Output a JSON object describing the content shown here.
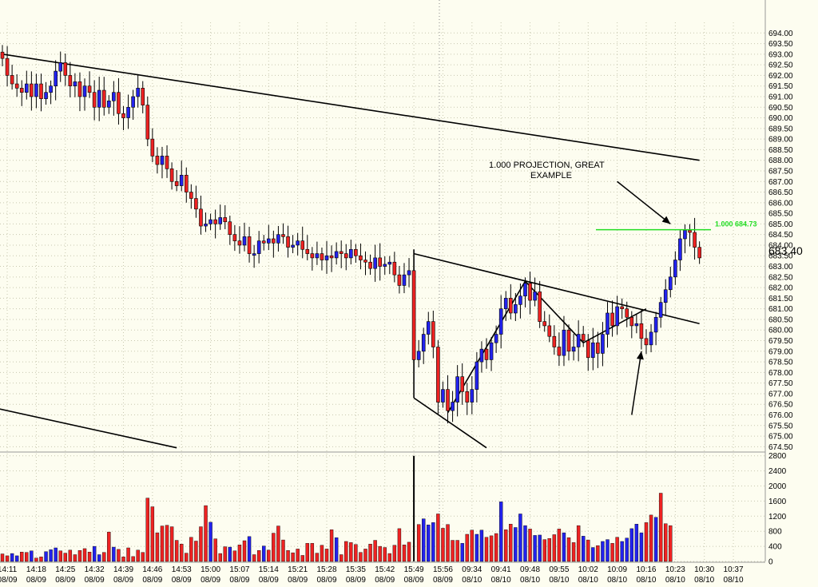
{
  "chart_data": {
    "type": "bar",
    "title": "",
    "ohlc_panel": {
      "ylim": [
        674.25,
        694.5
      ],
      "y_ticks": [
        "694.00",
        "693.50",
        "693.00",
        "692.50",
        "692.00",
        "691.50",
        "691.00",
        "690.50",
        "690.00",
        "689.50",
        "689.00",
        "688.50",
        "688.00",
        "687.50",
        "687.00",
        "686.50",
        "686.00",
        "685.50",
        "685.00",
        "684.50",
        "684.00",
        "683.50",
        "683.00",
        "682.50",
        "682.00",
        "681.50",
        "681.00",
        "680.50",
        "680.00",
        "679.50",
        "679.00",
        "678.50",
        "678.00",
        "677.50",
        "677.00",
        "676.50",
        "676.00",
        "675.50",
        "675.00",
        "674.50"
      ],
      "last_price": "683.40",
      "annotations": {
        "note_line1": "1.000 PROJECTION, GREAT",
        "note_line2": "EXAMPLE",
        "projection_label": "1.000 684.73",
        "projection_level": 684.73
      },
      "closes": [
        692.8,
        692.0,
        691.6,
        691.4,
        691.2,
        691.6,
        691.0,
        691.6,
        690.9,
        691.2,
        691.5,
        692.2,
        692.6,
        692.0,
        691.5,
        691.7,
        691.0,
        691.5,
        691.2,
        690.5,
        691.3,
        690.5,
        690.8,
        691.2,
        690.2,
        690.0,
        690.5,
        691.0,
        691.4,
        690.6,
        689.0,
        688.2,
        687.8,
        688.2,
        687.6,
        687.0,
        686.8,
        687.3,
        686.5,
        686.2,
        685.7,
        684.9,
        685.0,
        685.2,
        685.0,
        685.3,
        685.1,
        684.5,
        684.2,
        684.0,
        684.4,
        683.6,
        683.6,
        684.2,
        684.1,
        684.3,
        684.1,
        684.5,
        684.4,
        683.9,
        684.0,
        684.2,
        683.8,
        683.6,
        683.4,
        683.6,
        683.3,
        683.5,
        683.4,
        683.7,
        683.6,
        683.4,
        683.8,
        683.5,
        683.3,
        683.2,
        682.9,
        683.4,
        683.0,
        683.1,
        683.2,
        682.6,
        682.1,
        682.6,
        682.8,
        678.6,
        679.0,
        679.8,
        680.4,
        679.2,
        676.6,
        677.2,
        676.2,
        676.6,
        677.8,
        677.1,
        676.6,
        677.2,
        678.5,
        679.1,
        678.6,
        679.4,
        679.8,
        681.0,
        681.5,
        680.8,
        681.2,
        681.6,
        682.2,
        681.4,
        681.8,
        680.4,
        680.2,
        679.7,
        679.2,
        678.8,
        680.0,
        679.0,
        679.2,
        679.8,
        679.5,
        678.7,
        679.4,
        678.9,
        679.8,
        680.8,
        680.2,
        681.1,
        681.0,
        680.6,
        680.2,
        680.3,
        679.6,
        679.3,
        679.9,
        680.6,
        681.3,
        681.9,
        682.5,
        683.3,
        684.3,
        684.7,
        684.6,
        683.9,
        683.4
      ],
      "trendlines": [
        {
          "from": [
            0,
            693.0
          ],
          "to": [
            144,
            688.0
          ]
        },
        {
          "from": [
            -3,
            676.4
          ],
          "to": [
            36,
            674.45
          ]
        },
        {
          "from": [
            85,
            683.6
          ],
          "to": [
            144,
            680.3
          ]
        },
        {
          "from": [
            85,
            676.8
          ],
          "to": [
            100,
            674.45
          ]
        },
        {
          "from": [
            92,
            676.1
          ],
          "to": [
            108,
            682.3
          ]
        },
        {
          "from": [
            108,
            682.3
          ],
          "to": [
            120,
            679.4
          ]
        },
        {
          "from": [
            120,
            679.4
          ],
          "to": [
            133,
            681.0
          ]
        },
        {
          "from": [
            85,
            683.8
          ],
          "to": [
            85,
            676.8
          ]
        }
      ],
      "arrows": [
        {
          "from": [
            127,
            687.0
          ],
          "to": [
            138,
            685.0
          ]
        },
        {
          "from": [
            130,
            676.0
          ],
          "to": [
            132,
            679.0
          ]
        }
      ]
    },
    "volume_panel": {
      "ylim": [
        0,
        2900
      ],
      "y_ticks": [
        "2800",
        "2400",
        "2000",
        "1600",
        "1200",
        "800",
        "400",
        "0"
      ],
      "volumes": [
        200,
        150,
        210,
        150,
        250,
        240,
        280,
        90,
        120,
        260,
        310,
        360,
        280,
        220,
        300,
        180,
        290,
        340,
        250,
        400,
        180,
        240,
        780,
        380,
        320,
        120,
        360,
        130,
        300,
        240,
        1680,
        1450,
        760,
        940,
        960,
        920,
        560,
        460,
        220,
        640,
        540,
        920,
        1480,
        1040,
        600,
        210,
        390,
        380,
        280,
        440,
        550,
        660,
        180,
        290,
        410,
        300,
        750,
        940,
        570,
        290,
        230,
        330,
        160,
        480,
        480,
        220,
        430,
        330,
        840,
        630,
        180,
        530,
        500,
        450,
        240,
        330,
        460,
        560,
        400,
        370,
        210,
        430,
        870,
        440,
        510,
        2800,
        980,
        1130,
        970,
        1030,
        1260,
        880,
        980,
        560,
        560,
        480,
        720,
        830,
        720,
        830,
        640,
        680,
        740,
        1580,
        840,
        990,
        900,
        1260,
        950,
        860,
        690,
        700,
        580,
        610,
        710,
        860,
        760,
        630,
        500,
        950,
        670,
        570,
        370,
        420,
        530,
        580,
        480,
        640,
        530,
        620,
        870,
        990,
        760,
        1030,
        1230,
        1170,
        1810,
        1000,
        950
      ],
      "volume_colors": [
        "red",
        "red",
        "blue",
        "blue",
        "red",
        "red",
        "blue",
        "red",
        "red",
        "blue",
        "blue",
        "blue",
        "red",
        "red",
        "red",
        "red",
        "red",
        "red",
        "red",
        "blue",
        "blue",
        "red",
        "red",
        "blue",
        "red",
        "red",
        "red",
        "red",
        "red",
        "red",
        "red",
        "red",
        "red",
        "red",
        "red",
        "red",
        "red",
        "red",
        "red",
        "red",
        "red",
        "red",
        "red",
        "blue",
        "red",
        "red",
        "red",
        "blue",
        "red",
        "red",
        "red",
        "blue",
        "red",
        "red",
        "blue",
        "red",
        "red",
        "red",
        "red",
        "red",
        "red",
        "red",
        "red",
        "red",
        "red",
        "red",
        "red",
        "red",
        "red",
        "blue",
        "red",
        "red",
        "red",
        "red",
        "red",
        "red",
        "red",
        "red",
        "red",
        "red",
        "red",
        "red",
        "red",
        "red",
        "red",
        "black",
        "red",
        "blue",
        "blue",
        "blue",
        "red",
        "red",
        "red",
        "red",
        "red",
        "blue",
        "red",
        "red",
        "blue",
        "blue",
        "red",
        "red",
        "red",
        "blue",
        "red",
        "red",
        "blue",
        "blue",
        "blue",
        "red",
        "blue",
        "blue",
        "red",
        "red",
        "red",
        "red",
        "blue",
        "red",
        "red",
        "red",
        "blue",
        "red",
        "blue",
        "red",
        "blue",
        "blue",
        "red",
        "red",
        "blue",
        "blue",
        "blue",
        "blue",
        "blue",
        "red",
        "red",
        "blue",
        "red",
        "red",
        "red"
      ]
    },
    "x_tick_labels": [
      {
        "time": "14:11",
        "date": "08/09"
      },
      {
        "time": "14:18",
        "date": "08/09"
      },
      {
        "time": "14:25",
        "date": "08/09"
      },
      {
        "time": "14:32",
        "date": "08/09"
      },
      {
        "time": "14:39",
        "date": "08/09"
      },
      {
        "time": "14:46",
        "date": "08/09"
      },
      {
        "time": "14:53",
        "date": "08/09"
      },
      {
        "time": "15:00",
        "date": "08/09"
      },
      {
        "time": "15:07",
        "date": "08/09"
      },
      {
        "time": "15:14",
        "date": "08/09"
      },
      {
        "time": "15:21",
        "date": "08/09"
      },
      {
        "time": "15:28",
        "date": "08/09"
      },
      {
        "time": "15:35",
        "date": "08/09"
      },
      {
        "time": "15:42",
        "date": "08/09"
      },
      {
        "time": "15:49",
        "date": "08/09"
      },
      {
        "time": "15:56",
        "date": "08/09"
      },
      {
        "time": "09:34",
        "date": "08/10"
      },
      {
        "time": "09:41",
        "date": "08/10"
      },
      {
        "time": "09:48",
        "date": "08/10"
      },
      {
        "time": "09:55",
        "date": "08/10"
      },
      {
        "time": "10:02",
        "date": "08/10"
      },
      {
        "time": "10:09",
        "date": "08/10"
      },
      {
        "time": "10:16",
        "date": "08/10"
      },
      {
        "time": "10:23",
        "date": "08/10"
      },
      {
        "time": "10:30",
        "date": "08/10"
      },
      {
        "time": "10:37",
        "date": "08/10"
      }
    ],
    "colors": {
      "background": "#fdfdf0",
      "up": "#2222ee",
      "down": "#ee2222",
      "projection": "#22dd22",
      "grid": "#c8c8b0"
    }
  }
}
